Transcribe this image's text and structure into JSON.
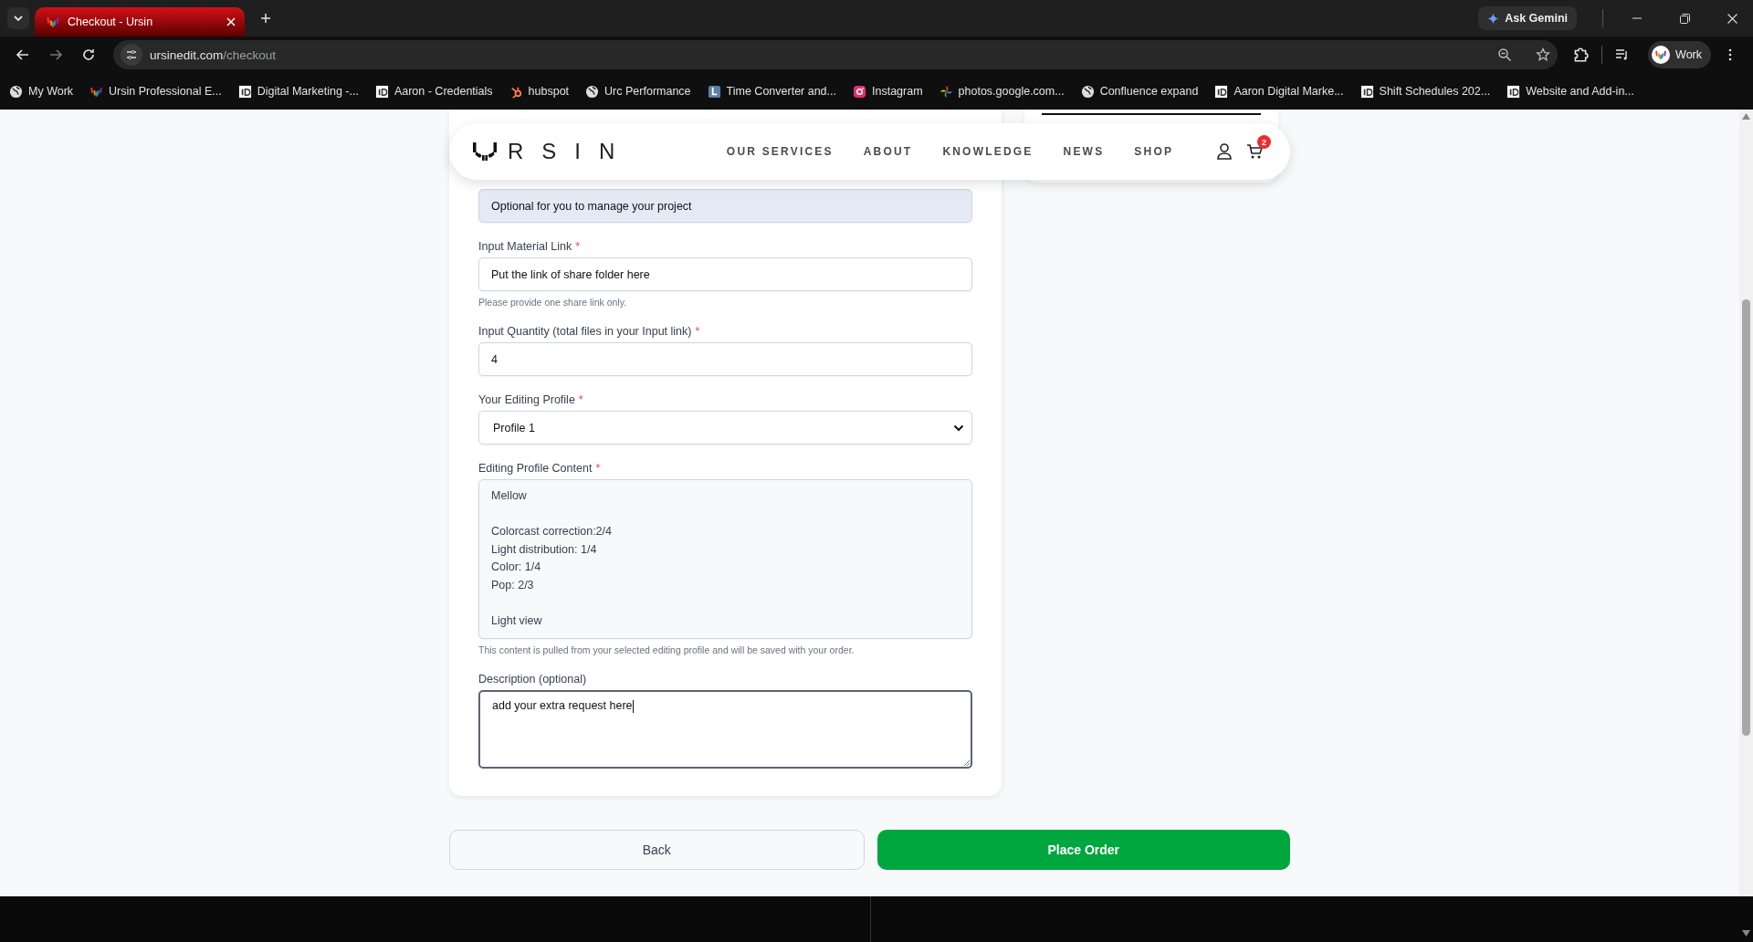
{
  "browser": {
    "tabs": [
      {
        "title": "Checkout - Ursin",
        "selected": true
      }
    ],
    "ask_gemini": "Ask Gemini",
    "url": {
      "host": "ursinedit.com",
      "path": "/checkout"
    },
    "profile": "Work",
    "bookmarks": [
      {
        "label": "My Work",
        "kind": "globe"
      },
      {
        "label": "Ursin Professional E...",
        "kind": "brand"
      },
      {
        "label": "Digital Marketing -...",
        "kind": "id"
      },
      {
        "label": "Aaron - Credentials",
        "kind": "id"
      },
      {
        "label": "hubspot",
        "kind": "hubspot"
      },
      {
        "label": "Urc Performance",
        "kind": "globe"
      },
      {
        "label": "Time Converter and...",
        "kind": "clock"
      },
      {
        "label": "Instagram",
        "kind": "instagram"
      },
      {
        "label": "photos.google.com...",
        "kind": "pinwheel"
      },
      {
        "label": "Confluence expand",
        "kind": "globe"
      },
      {
        "label": "Aaron Digital Marke...",
        "kind": "id"
      },
      {
        "label": "Shift Schedules 202...",
        "kind": "id"
      },
      {
        "label": "Website and Add-in...",
        "kind": "id"
      }
    ]
  },
  "header": {
    "brand": "RSIN",
    "nav": [
      "OUR SERVICES",
      "ABOUT",
      "KNOWLEDGE",
      "NEWS",
      "SHOP"
    ],
    "cart_count": "2"
  },
  "form": {
    "fields": [
      {
        "kind": "text",
        "value": "Optional for you to manage your project",
        "autofilled": true
      },
      {
        "kind": "text",
        "label": "Input Material Link",
        "required_mark": "*",
        "value": "Put the link of share folder here",
        "hint": "Please provide one share link only."
      },
      {
        "kind": "text",
        "label": "Input Quantity (total files in your Input link)",
        "required_mark": "*",
        "value": "4"
      },
      {
        "kind": "select",
        "label": "Your Editing Profile",
        "required_mark": "*",
        "value": "Profile 1"
      },
      {
        "kind": "readonly",
        "label": "Editing Profile Content",
        "required_mark": "*",
        "value": "Mellow\n\nColorcast correction:2/4\nLight distribution: 1/4\nColor: 1/4\nPop: 2/3\n\nLight view",
        "hint": "This content is pulled from your selected editing profile and will be saved with your order."
      },
      {
        "kind": "textarea",
        "label": "Description (optional)",
        "value": "add your extra request here",
        "focused": true
      }
    ]
  },
  "buttons": [
    {
      "label": "Back",
      "kind": "secondary"
    },
    {
      "label": "Place Order",
      "kind": "primary"
    }
  ]
}
